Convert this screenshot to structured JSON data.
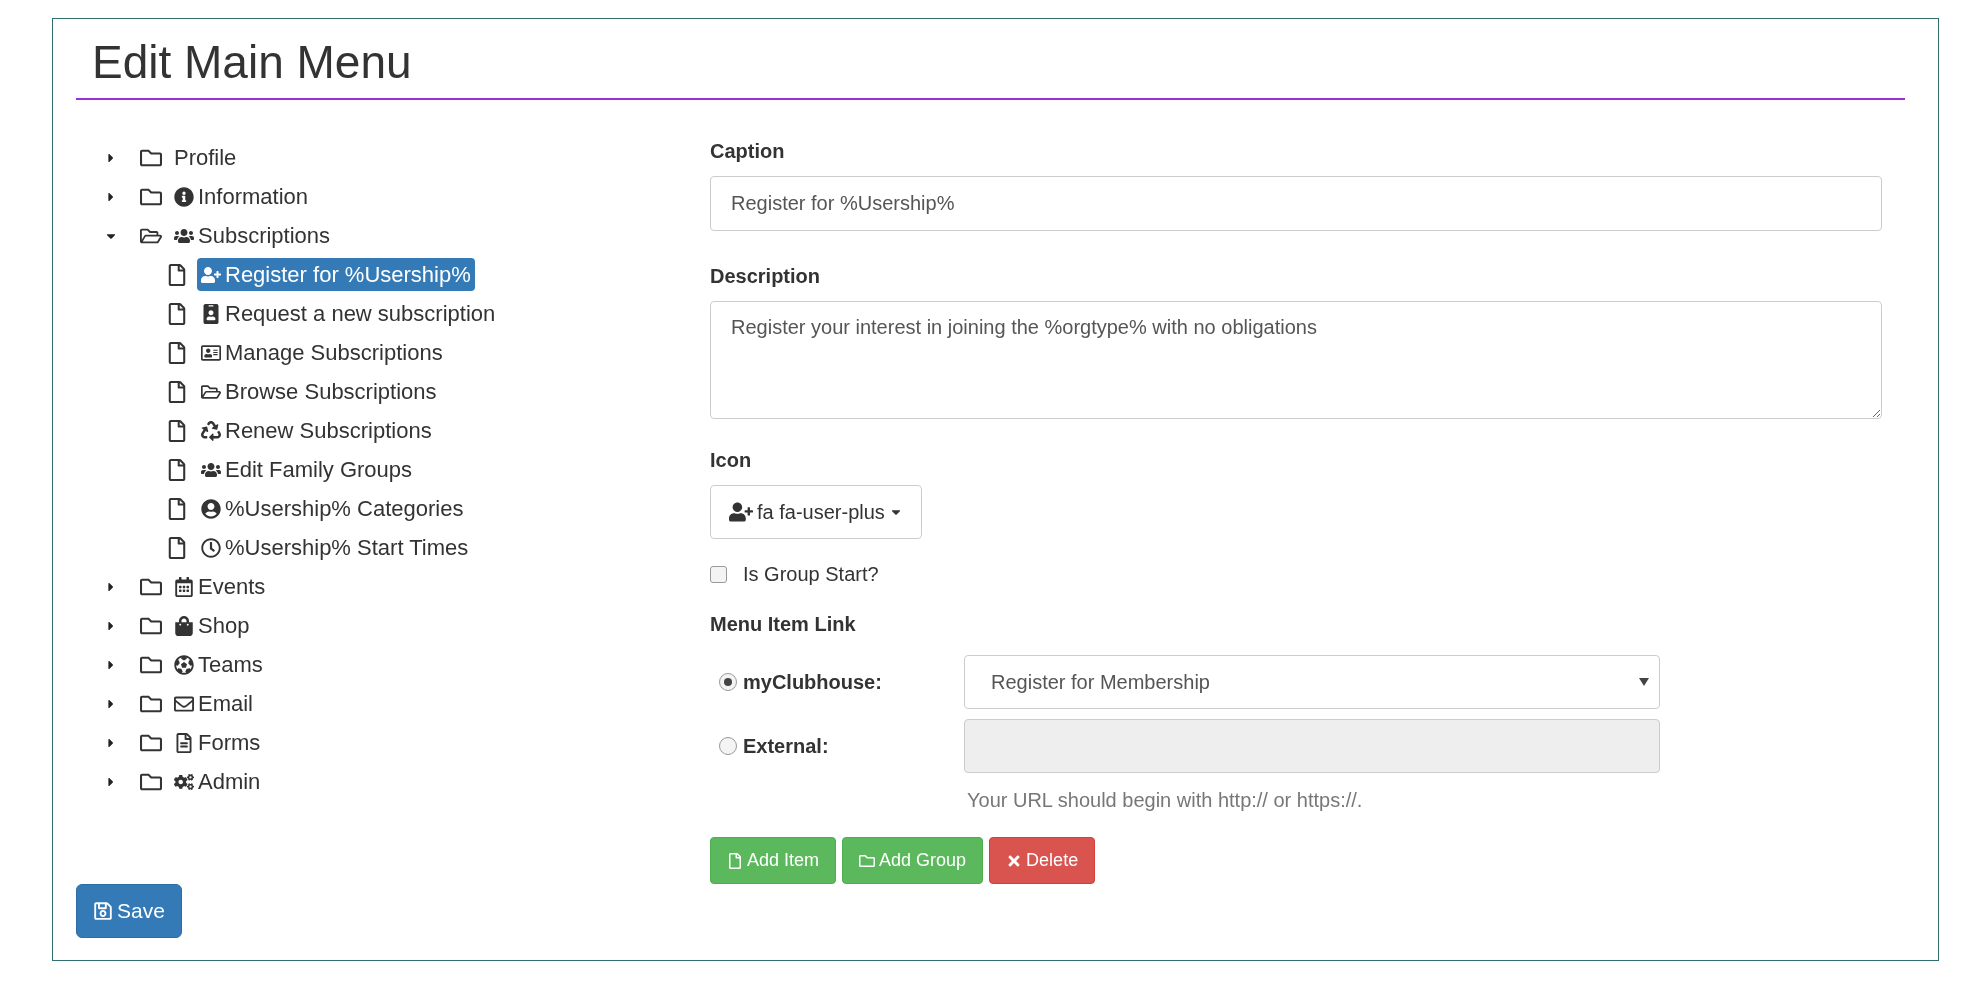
{
  "title": "Edit Main Menu",
  "tree": [
    {
      "kind": "group",
      "label": "Profile",
      "expanded": false,
      "selected": false
    },
    {
      "kind": "group",
      "label": "Information",
      "expanded": false,
      "selected": false
    },
    {
      "kind": "group",
      "label": "Subscriptions",
      "expanded": true,
      "selected": false,
      "children": [
        {
          "kind": "item",
          "label": "Register for %Usership%",
          "selected": true
        },
        {
          "kind": "item",
          "label": "Request a new subscription",
          "selected": false
        },
        {
          "kind": "item",
          "label": "Manage Subscriptions",
          "selected": false
        },
        {
          "kind": "item",
          "label": "Browse Subscriptions",
          "selected": false
        },
        {
          "kind": "item",
          "label": "Renew Subscriptions",
          "selected": false
        },
        {
          "kind": "item",
          "label": "Edit Family Groups",
          "selected": false
        },
        {
          "kind": "item",
          "label": "%Usership% Categories",
          "selected": false
        },
        {
          "kind": "item",
          "label": "%Usership% Start Times",
          "selected": false
        }
      ]
    },
    {
      "kind": "group",
      "label": "Events",
      "expanded": false,
      "selected": false
    },
    {
      "kind": "group",
      "label": "Shop",
      "expanded": false,
      "selected": false
    },
    {
      "kind": "group",
      "label": "Teams",
      "expanded": false,
      "selected": false
    },
    {
      "kind": "group",
      "label": "Email",
      "expanded": false,
      "selected": false
    },
    {
      "kind": "group",
      "label": "Forms",
      "expanded": false,
      "selected": false
    },
    {
      "kind": "group",
      "label": "Admin",
      "expanded": false,
      "selected": false
    }
  ],
  "save_button": "Save",
  "form": {
    "caption": {
      "label": "Caption",
      "value": "Register for %Usership%"
    },
    "description": {
      "label": "Description",
      "value": "Register your interest in joining the %orgtype% with no obligations"
    },
    "icon": {
      "label": "Icon",
      "value": "fa fa-user-plus"
    },
    "group_start": {
      "label": "Is Group Start?",
      "checked": false
    },
    "link": {
      "label": "Menu Item Link",
      "options": [
        {
          "label": "myClubhouse:",
          "selected": true,
          "kind": "select",
          "value": "Register for Membership"
        },
        {
          "label": "External:",
          "selected": false,
          "kind": "text"
        }
      ],
      "help": "Your URL should begin with http:// or https://."
    },
    "buttons": [
      {
        "kind": "add-item",
        "label": "Add Item"
      },
      {
        "kind": "add-group",
        "label": "Add Group"
      },
      {
        "kind": "delete",
        "label": "Delete"
      }
    ]
  }
}
